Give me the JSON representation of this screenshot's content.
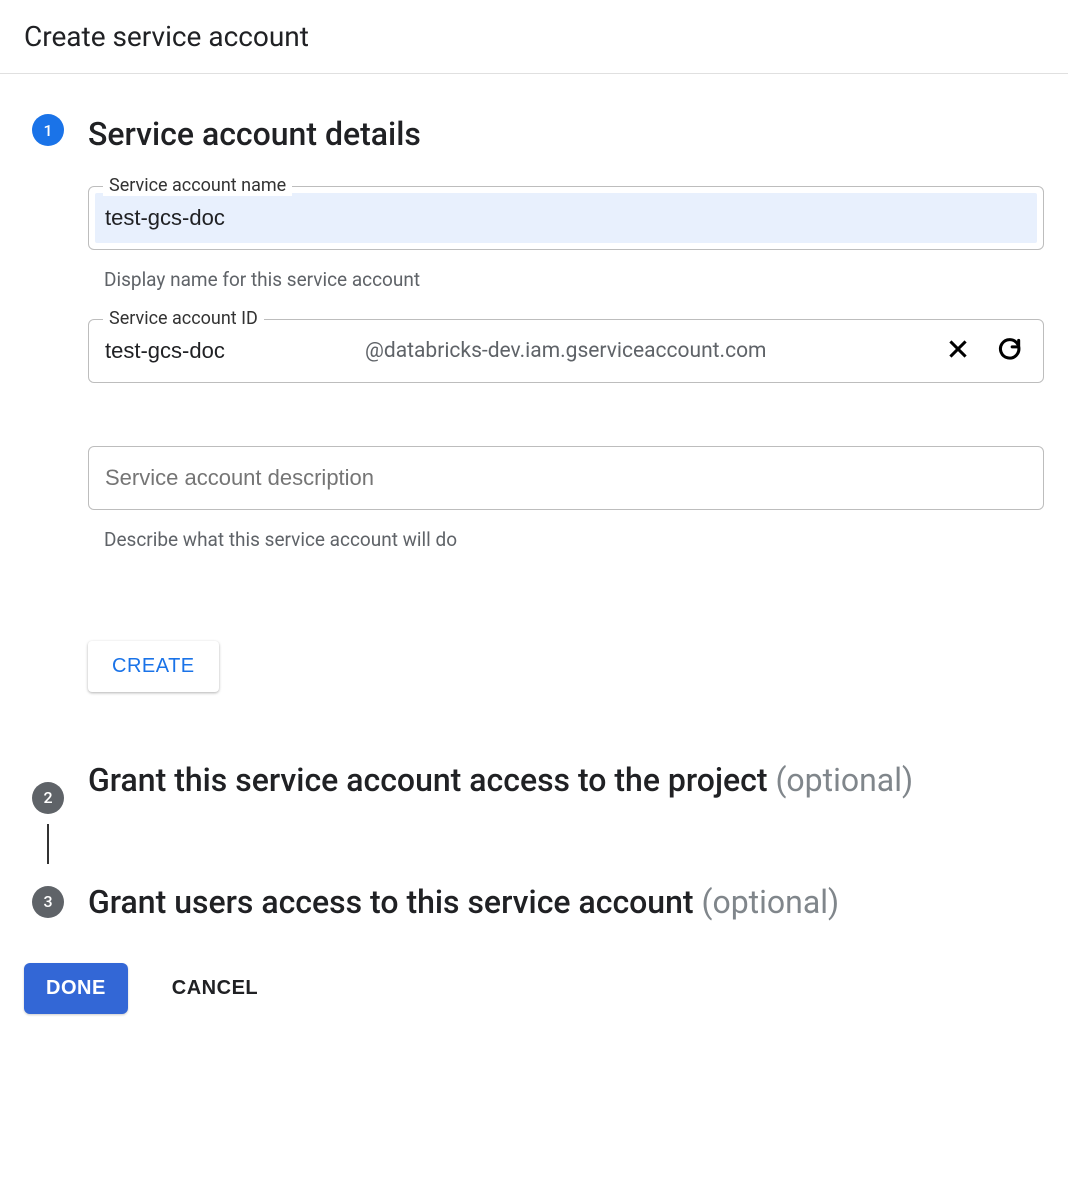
{
  "page": {
    "title": "Create service account"
  },
  "steps": {
    "step1": {
      "number": "1",
      "heading": "Service account details",
      "name_field": {
        "label": "Service account name",
        "value": "test-gcs-doc",
        "helper": "Display name for this service account"
      },
      "id_field": {
        "label": "Service account ID",
        "value": "test-gcs-doc",
        "suffix": "@databricks-dev.iam.gserviceaccount.com"
      },
      "description_field": {
        "placeholder": "Service account description",
        "value": "",
        "helper": "Describe what this service account will do"
      },
      "create_button": "CREATE"
    },
    "step2": {
      "number": "2",
      "heading": "Grant this service account access to the project",
      "optional": " (optional)"
    },
    "step3": {
      "number": "3",
      "heading": "Grant users access to this service account",
      "optional": " (optional)"
    }
  },
  "footer": {
    "done": "DONE",
    "cancel": "CANCEL"
  }
}
